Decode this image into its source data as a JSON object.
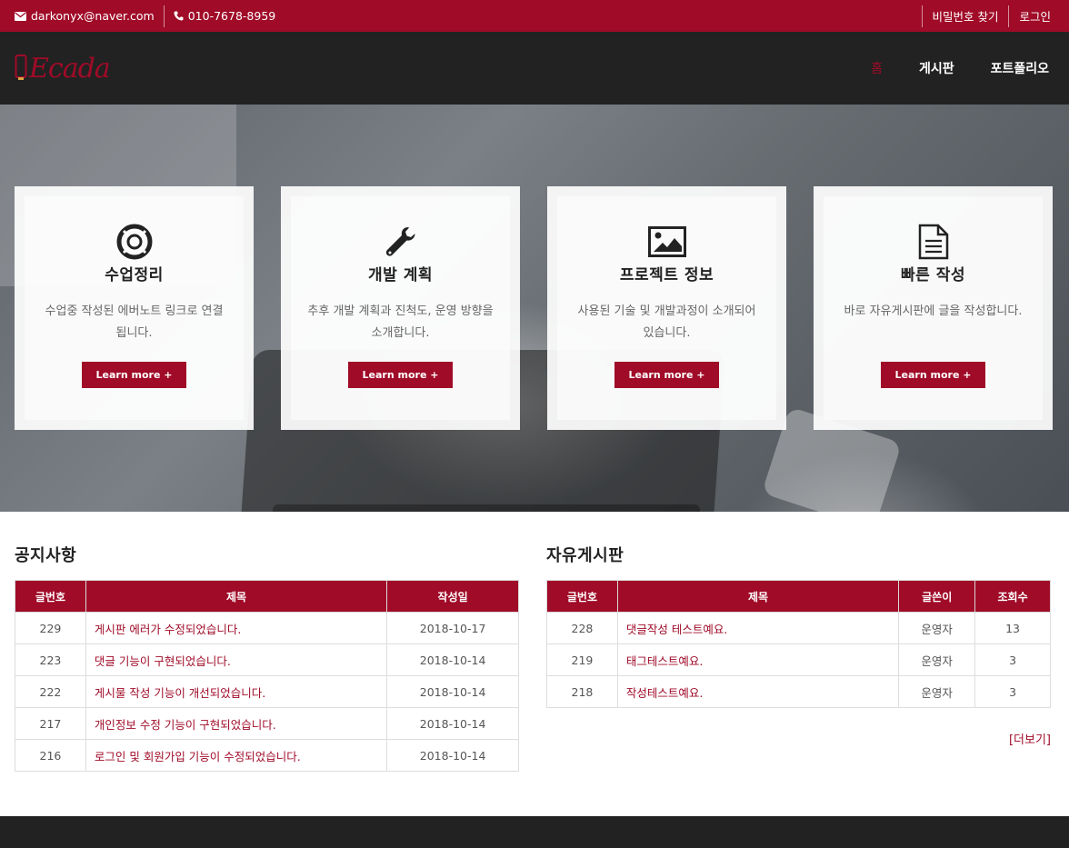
{
  "topbar": {
    "email": "darkonyx@naver.com",
    "phone": "010-7678-8959",
    "find_password": "비밀번호 찾기",
    "login": "로그인"
  },
  "nav": {
    "logo": "Ecada",
    "items": [
      "홈",
      "게시판",
      "포트폴리오"
    ]
  },
  "colors": {
    "accent": "#a00b28",
    "dark": "#222222"
  },
  "cards": [
    {
      "icon": "life-ring-icon",
      "title": "수업정리",
      "desc": "수업중 작성된 에버노트 링크로 연결됩니다.",
      "button": "Learn more +"
    },
    {
      "icon": "wrench-icon",
      "title": "개발 계획",
      "desc": "추후 개발 계획과 진척도, 운영 방향을 소개합니다.",
      "button": "Learn more +"
    },
    {
      "icon": "image-icon",
      "title": "프로젝트 정보",
      "desc": "사용된 기술 및 개발과정이 소개되어 있습니다.",
      "button": "Learn more +"
    },
    {
      "icon": "document-icon",
      "title": "빠른 작성",
      "desc": "바로 자유게시판에 글을 작성합니다.",
      "button": "Learn more +"
    }
  ],
  "notice": {
    "title": "공지사항",
    "headers": [
      "글번호",
      "제목",
      "작성일"
    ],
    "rows": [
      [
        "229",
        "게시판 에러가 수정되었습니다.",
        "2018-10-17"
      ],
      [
        "223",
        "댓글 기능이 구현되었습니다.",
        "2018-10-14"
      ],
      [
        "222",
        "게시물 작성 기능이 개선되었습니다.",
        "2018-10-14"
      ],
      [
        "217",
        "개인정보 수정 기능이 구현되었습니다.",
        "2018-10-14"
      ],
      [
        "216",
        "로그인 및 회원가입 기능이 수정되었습니다.",
        "2018-10-14"
      ]
    ]
  },
  "board": {
    "title": "자유게시판",
    "headers": [
      "글번호",
      "제목",
      "글쓴이",
      "조회수"
    ],
    "rows": [
      [
        "228",
        "댓글작성 테스트예요.",
        "운영자",
        "13"
      ],
      [
        "219",
        "태그테스트예요.",
        "운영자",
        "3"
      ],
      [
        "218",
        "작성테스트예요.",
        "운영자",
        "3"
      ]
    ],
    "more": "[더보기]"
  }
}
